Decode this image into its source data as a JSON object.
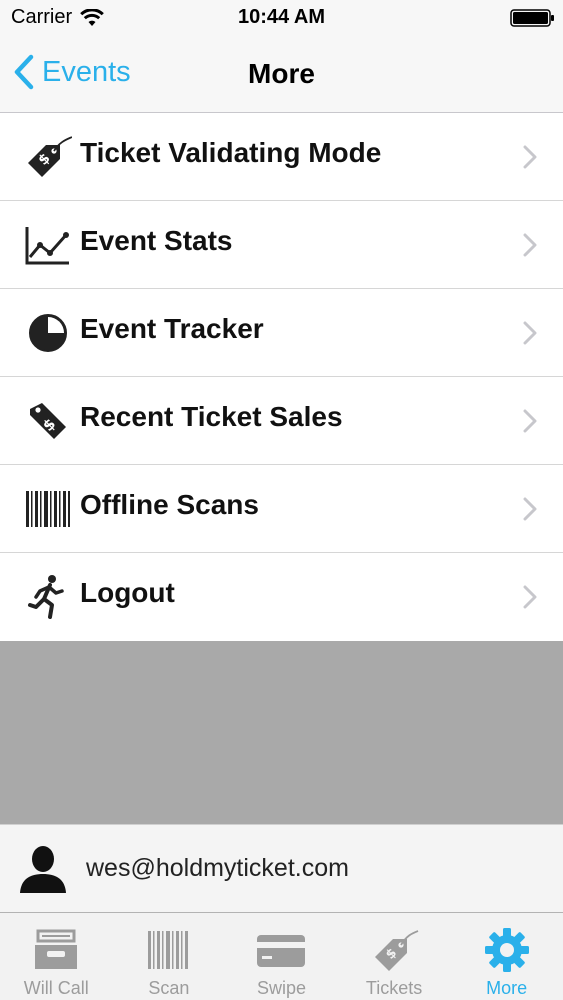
{
  "status_bar": {
    "carrier": "Carrier",
    "time": "10:44 AM"
  },
  "nav": {
    "back_label": "Events",
    "title": "More"
  },
  "menu": {
    "items": [
      {
        "label": "Ticket Validating Mode",
        "icon": "ticket-tag-icon"
      },
      {
        "label": "Event Stats",
        "icon": "line-chart-icon"
      },
      {
        "label": "Event Tracker",
        "icon": "pie-tracker-icon"
      },
      {
        "label": "Recent Ticket Sales",
        "icon": "price-tag-icon"
      },
      {
        "label": "Offline Scans",
        "icon": "barcode-icon"
      },
      {
        "label": "Logout",
        "icon": "running-man-icon"
      }
    ]
  },
  "user": {
    "email": "wes@holdmyticket.com"
  },
  "tabs": [
    {
      "label": "Will Call",
      "icon": "inbox-tray-icon",
      "active": false
    },
    {
      "label": "Scan",
      "icon": "barcode-icon",
      "active": false
    },
    {
      "label": "Swipe",
      "icon": "credit-card-icon",
      "active": false
    },
    {
      "label": "Tickets",
      "icon": "ticket-tag-icon",
      "active": false
    },
    {
      "label": "More",
      "icon": "gear-icon",
      "active": true
    }
  ],
  "colors": {
    "accent": "#2ab0ea",
    "inactive_tab": "#9c9c9c",
    "empty_area": "#a9a9a9"
  }
}
